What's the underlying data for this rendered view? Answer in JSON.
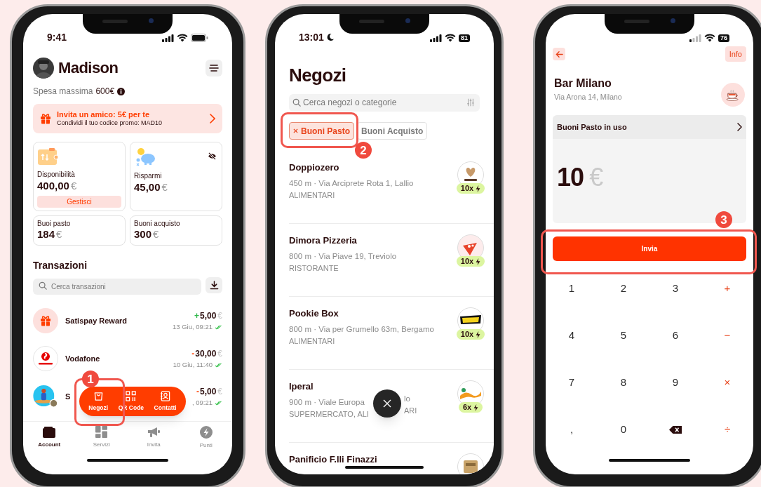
{
  "account_screen": {
    "status_bar": {
      "time": "9:41"
    },
    "user": {
      "name": "Madison"
    },
    "spending_limit": {
      "label": "Spesa massima",
      "value": "600€"
    },
    "promo": {
      "title": "Invita un amico: 5€ per te",
      "subtitle": "Condividi il tuo codice promo: MAD10"
    },
    "balances": [
      {
        "kind": "wallet",
        "label": "Disponibilità",
        "amount": "400,00",
        "currency": "€",
        "action": "Gestisci"
      },
      {
        "kind": "savings",
        "label": "Risparmi",
        "amount": "45,00",
        "currency": "€"
      },
      {
        "kind": "plain",
        "label": "Buoi pasto",
        "amount": "184",
        "currency": "€"
      },
      {
        "kind": "plain",
        "label": "Buoni acquisto",
        "amount": "300",
        "currency": "€"
      }
    ],
    "transactions_title": "Transazioni",
    "transactions_search": {
      "placeholder": "Cerca transazioni"
    },
    "transactions": [
      {
        "kind": "reward",
        "name": "Satispay Reward",
        "sign": "+",
        "incoming": true,
        "amount": "5,00",
        "currency": "€",
        "date": "13 Giu, 09:21"
      },
      {
        "kind": "brand",
        "name": "Vodafone",
        "sign": "-",
        "incoming": false,
        "amount": "30,00",
        "currency": "€",
        "date": "10 Giu, 11:40"
      },
      {
        "kind": "person",
        "name": "S",
        "sign": "-",
        "incoming": false,
        "amount": "5,00",
        "currency": "€",
        "date": ", 09:21"
      }
    ],
    "quick_actions": [
      {
        "label": "Negozi"
      },
      {
        "label": "QR Code"
      },
      {
        "label": "Contatti"
      }
    ],
    "step": "1",
    "tabs": [
      {
        "label": "Account",
        "selected": true
      },
      {
        "label": "Servizi",
        "selected": false
      },
      {
        "label": "Invita",
        "selected": false
      },
      {
        "label": "Punti",
        "selected": false
      }
    ]
  },
  "stores_screen": {
    "status_bar": {
      "time": "13:01",
      "battery": "81"
    },
    "title": "Negozi",
    "search": {
      "placeholder": "Cerca negozi o categorie"
    },
    "filters": [
      {
        "label": "Buoni Pasto",
        "selected": true
      },
      {
        "label": "Buoni Acquisto",
        "selected": false
      }
    ],
    "step": "2",
    "stores": [
      {
        "kind": "heart",
        "name": "Doppiozero",
        "address": "450 m · Via Arciprete Rota 1, Lallio",
        "category": "ALIMENTARI",
        "multiplier": "10x"
      },
      {
        "kind": "pizza",
        "name": "Dimora Pizzeria",
        "address": "800 m · Via Piave 19, Treviolo",
        "category": "RISTORANTE",
        "multiplier": "10x"
      },
      {
        "kind": "label",
        "name": "Pookie Box",
        "address": "800 m · Via per Grumello 63m, Bergamo",
        "category": "ALIMENTARI",
        "multiplier": "10x"
      },
      {
        "kind": "swirl",
        "name": "Iperal",
        "address": "900 m · Viale Europa",
        "address_end": "lo",
        "category": "SUPERMERCATO, ALI",
        "category_end": "ARI",
        "multiplier": "6x"
      },
      {
        "kind": "bread",
        "name": "Panificio F.lli Finazzi"
      }
    ]
  },
  "payment_screen": {
    "status_bar": {
      "battery": "76"
    },
    "info_button": "Info",
    "merchant": {
      "name": "Bar Milano",
      "address": "Via Arona 14, Milano"
    },
    "voucher_selector": "Buoni Pasto in uso",
    "amount": "10",
    "currency": "€",
    "submit": "Invia",
    "step": "3",
    "keys": [
      {
        "kind": "digit",
        "label": "1"
      },
      {
        "kind": "digit",
        "label": "2"
      },
      {
        "kind": "digit",
        "label": "3"
      },
      {
        "kind": "operator",
        "label": "+"
      },
      {
        "kind": "digit",
        "label": "4"
      },
      {
        "kind": "digit",
        "label": "5"
      },
      {
        "kind": "digit",
        "label": "6"
      },
      {
        "kind": "operator",
        "label": "−"
      },
      {
        "kind": "digit",
        "label": "7"
      },
      {
        "kind": "digit",
        "label": "8"
      },
      {
        "kind": "digit",
        "label": "9"
      },
      {
        "kind": "operator",
        "label": "×"
      },
      {
        "kind": "digit",
        "label": ","
      },
      {
        "kind": "digit",
        "label": "0"
      },
      {
        "kind": "backspace"
      },
      {
        "kind": "operator",
        "label": "÷"
      }
    ]
  }
}
